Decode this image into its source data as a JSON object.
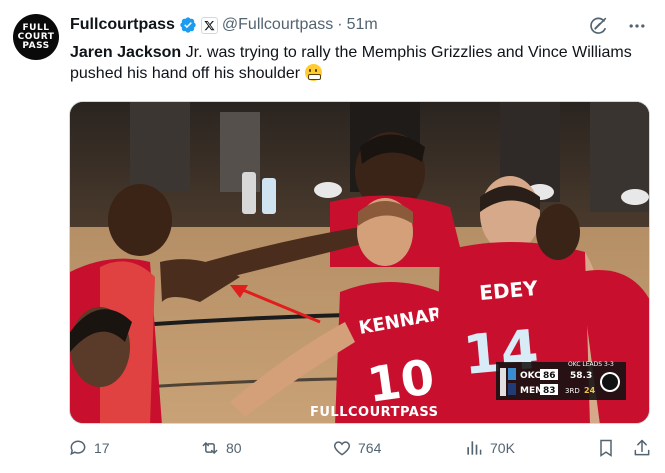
{
  "author": {
    "avatar_lines": [
      "FULL",
      "COURT",
      "PASS"
    ],
    "name": "Fullcourtpass",
    "handle": "@Fullcourtpass",
    "separator": "·",
    "time": "51m"
  },
  "tweet": {
    "text_bold": "Jaren Jackson",
    "text_rest": " Jr. was trying to rally the Memphis Grizzlies and Vince Williams pushed his hand off his shoulder "
  },
  "media": {
    "watermark": "FULLCOURTPASS",
    "jersey_left": "EDEY",
    "jersey_left_number": "14",
    "jersey_mid": "KENNAR",
    "jersey_mid_number": "10",
    "scorebug": {
      "team1": "OKC",
      "score1": "86",
      "team2": "MEM",
      "score2": "83",
      "clock": "58.3",
      "period": "3RD",
      "shot_clock": "24",
      "lead_text": "OKC LEADS 3-3"
    }
  },
  "actions": {
    "replies": "17",
    "reposts": "80",
    "likes": "764",
    "views": "70K"
  },
  "colors": {
    "verified": "#1d9bf0",
    "secondary_text": "#536471",
    "jersey_red": "#c8102e"
  }
}
